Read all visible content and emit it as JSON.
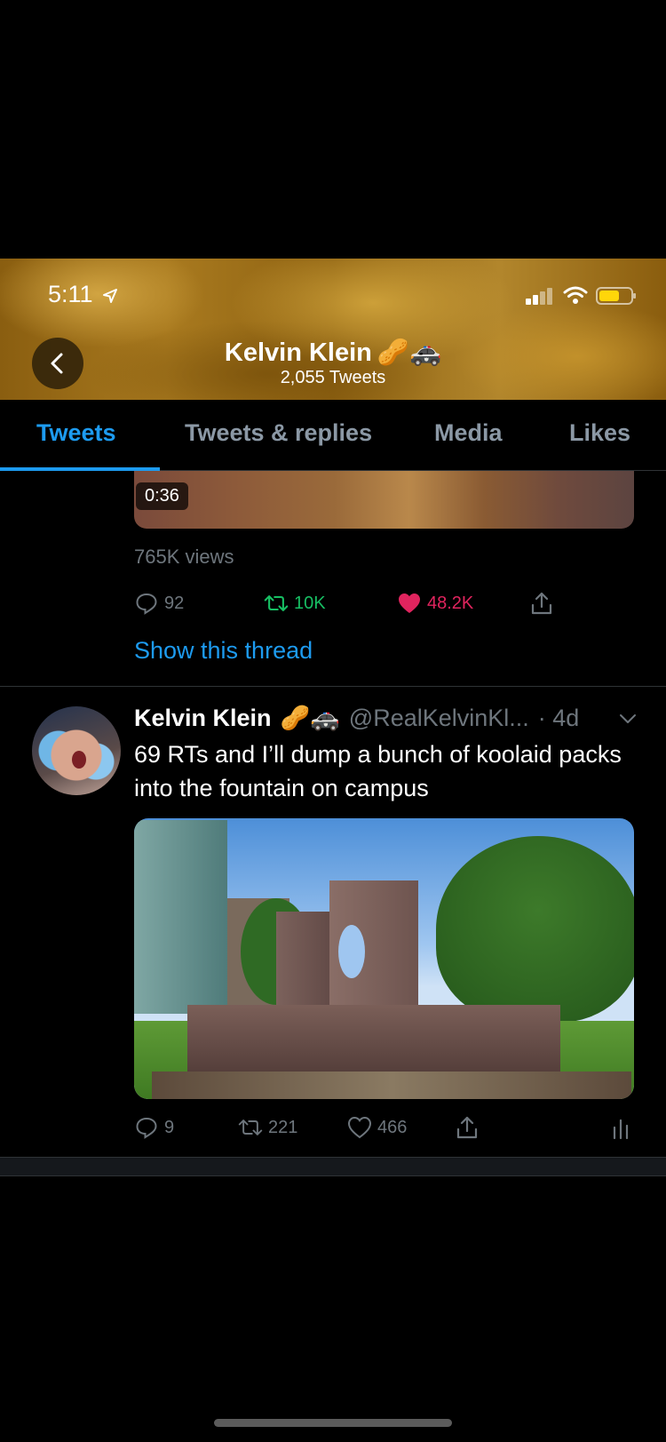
{
  "status_bar": {
    "time": "5:11"
  },
  "header": {
    "name": "Kelvin Klein",
    "name_emojis": "🥜🚓",
    "tweet_count": "2,055 Tweets"
  },
  "tabs": [
    {
      "label": "Tweets",
      "active": true
    },
    {
      "label": "Tweets & replies",
      "active": false
    },
    {
      "label": "Media",
      "active": false
    },
    {
      "label": "Likes",
      "active": false
    }
  ],
  "tweet1": {
    "video_duration": "0:36",
    "views": "765K views",
    "replies": "92",
    "retweets": "10K",
    "likes": "48.2K",
    "retweet_color": "#17bf63",
    "like_color": "#e0245e",
    "show_thread": "Show this thread"
  },
  "tweet2": {
    "name": "Kelvin Klein",
    "name_emojis": "🥜🚓",
    "handle": "@RealKelvinKl...",
    "time": "· 4d",
    "text": "69 RTs and I’ll dump a bunch of koolaid packs into the fountain on campus",
    "replies": "9",
    "retweets": "221",
    "likes": "466"
  },
  "colors": {
    "accent": "#1d9bf0",
    "muted": "#6e767d",
    "background": "#000000"
  }
}
